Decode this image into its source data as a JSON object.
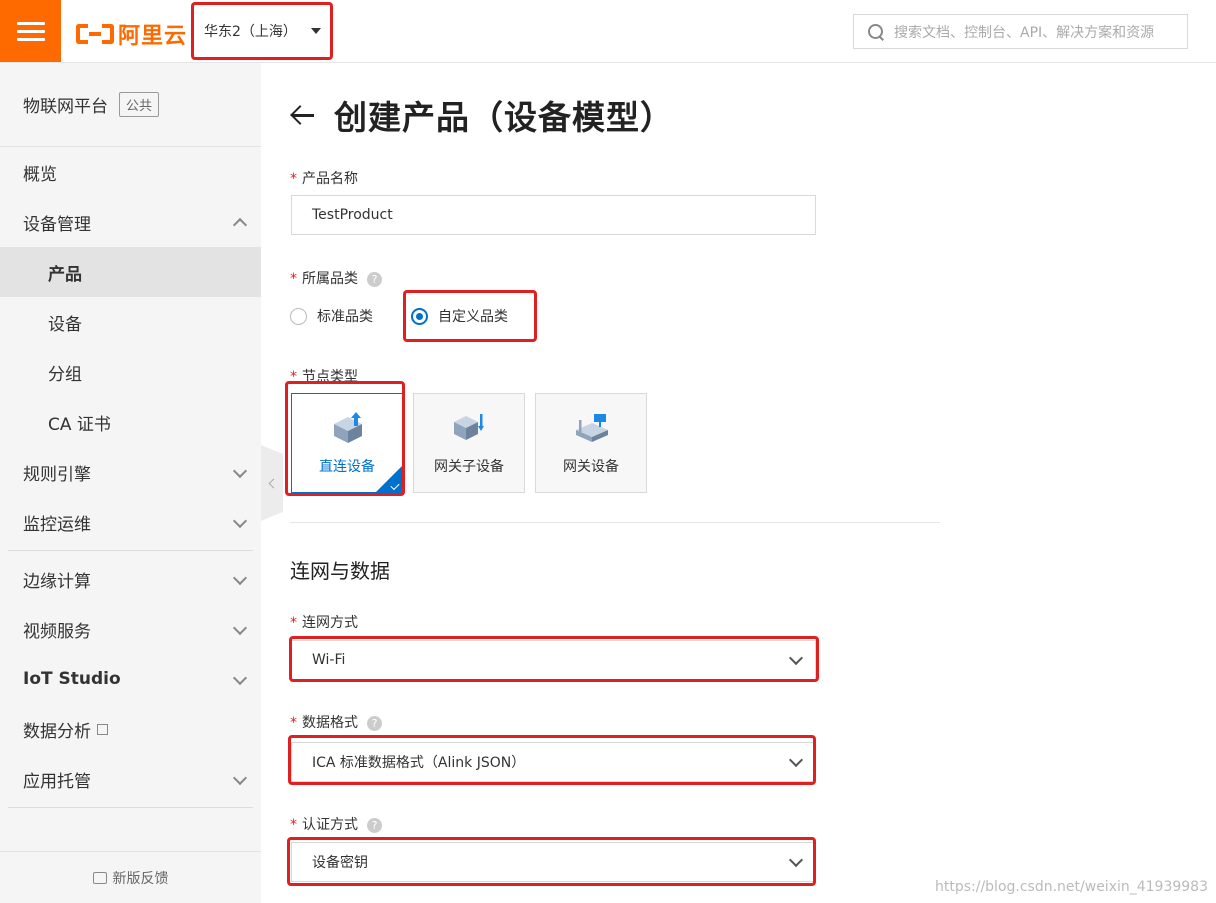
{
  "topbar": {
    "brand": "阿里云",
    "region": "华东2（上海）",
    "search_placeholder": "搜索文档、控制台、API、解决方案和资源"
  },
  "sidebar": {
    "platform": "物联网平台",
    "platform_tag": "公共",
    "items": [
      {
        "label": "概览",
        "level": 1,
        "expandable": false
      },
      {
        "label": "设备管理",
        "level": 1,
        "expandable": true,
        "expanded": true
      },
      {
        "label": "产品",
        "level": 2,
        "active": true
      },
      {
        "label": "设备",
        "level": 2
      },
      {
        "label": "分组",
        "level": 2
      },
      {
        "label": "CA 证书",
        "level": 2
      },
      {
        "label": "规则引擎",
        "level": 1,
        "expandable": true
      },
      {
        "label": "监控运维",
        "level": 1,
        "expandable": true
      },
      {
        "label": "边缘计算",
        "level": 1,
        "expandable": true
      },
      {
        "label": "视频服务",
        "level": 1,
        "expandable": true
      },
      {
        "label": "IoT Studio",
        "level": 1,
        "expandable": true
      },
      {
        "label": "数据分析",
        "level": 1,
        "external": true
      },
      {
        "label": "应用托管",
        "level": 1,
        "expandable": true
      }
    ],
    "feedback": "新版反馈"
  },
  "main": {
    "title": "创建产品（设备模型）",
    "product_name": {
      "label": "产品名称",
      "value": "TestProduct"
    },
    "category": {
      "label": "所属品类",
      "options": [
        "标准品类",
        "自定义品类"
      ],
      "selected": "自定义品类"
    },
    "node_type": {
      "label": "节点类型",
      "options": [
        "直连设备",
        "网关子设备",
        "网关设备"
      ],
      "selected": "直连设备"
    },
    "section_title": "连网与数据",
    "network": {
      "label": "连网方式",
      "value": "Wi-Fi"
    },
    "data_format": {
      "label": "数据格式",
      "value": "ICA 标准数据格式（Alink JSON）"
    },
    "auth": {
      "label": "认证方式",
      "value": "设备密钥"
    }
  },
  "watermark": "https://blog.csdn.net/weixin_41939983",
  "colors": {
    "brand": "#ff6a00",
    "accent": "#0070cc",
    "highlight": "#e02020"
  }
}
